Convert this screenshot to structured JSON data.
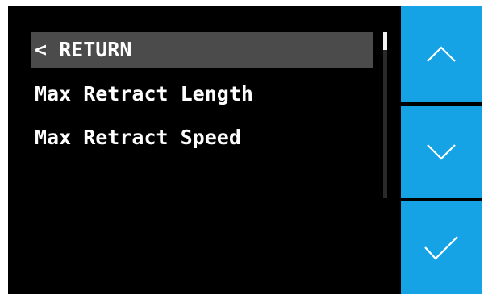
{
  "menu": {
    "items": [
      {
        "label": "< RETURN",
        "selected": true
      },
      {
        "label": "Max Retract Length",
        "selected": false
      },
      {
        "label": "Max Retract Speed",
        "selected": false
      }
    ]
  },
  "nav": {
    "up_icon": "chevron-up-icon",
    "down_icon": "chevron-down-icon",
    "confirm_icon": "checkmark-icon"
  },
  "colors": {
    "background": "#000000",
    "selected_row": "#4b4b4b",
    "accent": "#16a3e6",
    "text": "#ffffff"
  }
}
